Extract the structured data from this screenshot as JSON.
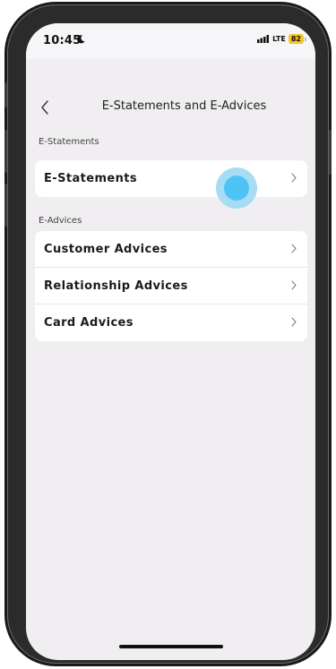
{
  "status_bar": {
    "time": "10:45",
    "network": "LTE",
    "battery": "82"
  },
  "header": {
    "title": "E-Statements and E-Advices"
  },
  "sections": [
    {
      "label": "E-Statements",
      "items": [
        {
          "label": "E-Statements"
        }
      ]
    },
    {
      "label": "E-Advices",
      "items": [
        {
          "label": "Customer Advices"
        },
        {
          "label": "Relationship Advices"
        },
        {
          "label": "Card Advices"
        }
      ]
    }
  ],
  "colors": {
    "screen_bg": "#f0eef0",
    "card_bg": "#ffffff",
    "tap_indicator": "#4ec3f5",
    "battery_badge": "#f3c62a"
  }
}
